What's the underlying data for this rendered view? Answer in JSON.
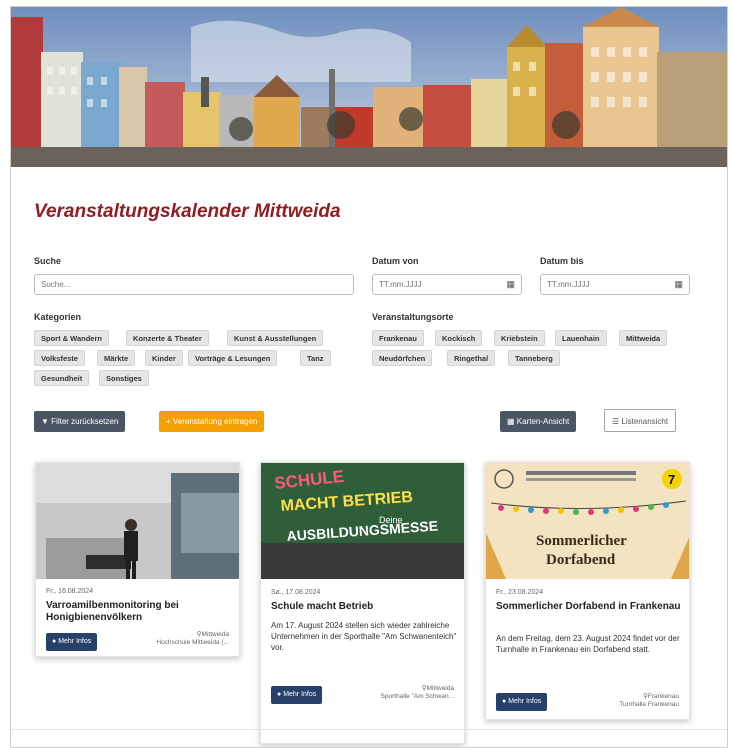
{
  "page": {
    "title": "Veranstaltungskalender Mittweida"
  },
  "filters": {
    "search_label": "Suche",
    "search_placeholder": "Suche...",
    "date_from_label": "Datum von",
    "date_from_placeholder": "TT.mm.JJJJ",
    "date_to_label": "Datum bis",
    "date_to_placeholder": "TT.mm.JJJJ",
    "categories_label": "Kategorien",
    "categories": [
      "Sport & Wandern",
      "Konzerte & Theater",
      "Kunst & Ausstellungen",
      "Volksfeste",
      "Märkte",
      "Kinder",
      "Vorträge & Lesungen",
      "Tanz",
      "Gesundheit",
      "Sonstiges"
    ],
    "locations_label": "Veranstaltungsorte",
    "locations": [
      "Frankenau",
      "Kockisch",
      "Kriebstein",
      "Lauenhain",
      "Mittweida",
      "Neudörfchen",
      "Ringethal",
      "Tanneberg"
    ]
  },
  "actions": {
    "reset_label": "Filter zurücksetzen",
    "add_label": "+ Veranstaltung eintragen",
    "map_view_label": "Karten-Ansicht",
    "list_view_label": "Listenansicht"
  },
  "events": [
    {
      "date": "Fr., 16.08.2024",
      "title": "Varroamilbenmonitoring bei Honigbienenvölkern",
      "description": "",
      "more_label": "Mehr Infos",
      "location_city": "Mittweida",
      "location_venue": "Hochschule Mittweida (..."
    },
    {
      "date": "Sa., 17.08.2024",
      "title": "Schule macht Betrieb",
      "description": "Am 17. August 2024 stellen sich wieder zahlreiche Unternehmen in der Sporthalle \"Am Schwanenteich\" vor.",
      "more_label": "Mehr Infos",
      "location_city": "Mittweida",
      "location_venue": "Sporthalle \"Am Schwan...",
      "image_text_1": "SCHULE",
      "image_text_2": "MACHT BETRIEB",
      "image_text_3": "Deine",
      "image_text_4": "AUSBILDUNGSMESSE"
    },
    {
      "date": "Fr., 23.08.2024",
      "title": "Sommerlicher Dorfabend in Frankenau",
      "description": "An dem Freitag, dem 23. August 2024 findet vor der Turnhalle in Frankenau ein Dorfabend statt.",
      "more_label": "Mehr Infos",
      "location_city": "Frankenau",
      "location_venue": "Turnhalle Frankenau",
      "image_text_1": "Sommerlicher",
      "image_text_2": "Dorfabend",
      "image_badge": "7"
    }
  ]
}
